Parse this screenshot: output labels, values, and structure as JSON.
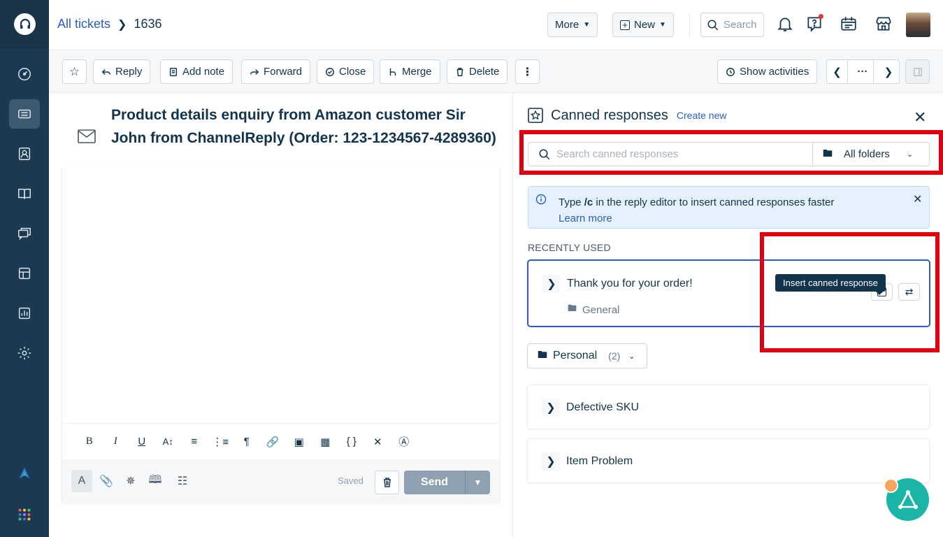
{
  "breadcrumb": {
    "link": "All tickets",
    "ticket_id": "1636"
  },
  "topbar": {
    "more_label": "More",
    "new_label": "New",
    "search_placeholder": "Search"
  },
  "toolbar": {
    "reply": "Reply",
    "add_note": "Add note",
    "forward": "Forward",
    "close": "Close",
    "merge": "Merge",
    "delete": "Delete",
    "show_activities": "Show activities",
    "pager_more": "···"
  },
  "ticket": {
    "subject": "Product details enquiry from Amazon customer Sir John from ChannelReply (Order: 123-1234567-4289360)"
  },
  "editor": {
    "saved_label": "Saved",
    "send_label": "Send"
  },
  "canned": {
    "title": "Canned responses",
    "create_new": "Create new",
    "search_placeholder": "Search canned responses",
    "folder_select": "All folders",
    "info_prefix": "Type ",
    "info_shortcut": "/c",
    "info_suffix": " in the reply editor to insert canned responses faster",
    "info_link": "Learn more",
    "recent_label": "RECENTLY USED",
    "recent_item": {
      "title": "Thank you for your order!",
      "folder": "General"
    },
    "tooltip": "Insert canned response",
    "personal_folder": {
      "label": "Personal",
      "count": "(2)"
    },
    "folders": [
      "Defective SKU",
      "Item Problem"
    ]
  },
  "colors": {
    "sidebar": "#1b3a52",
    "accent": "#2c5cc5",
    "highlight": "#e0000f",
    "fab": "#1bb5a8"
  }
}
